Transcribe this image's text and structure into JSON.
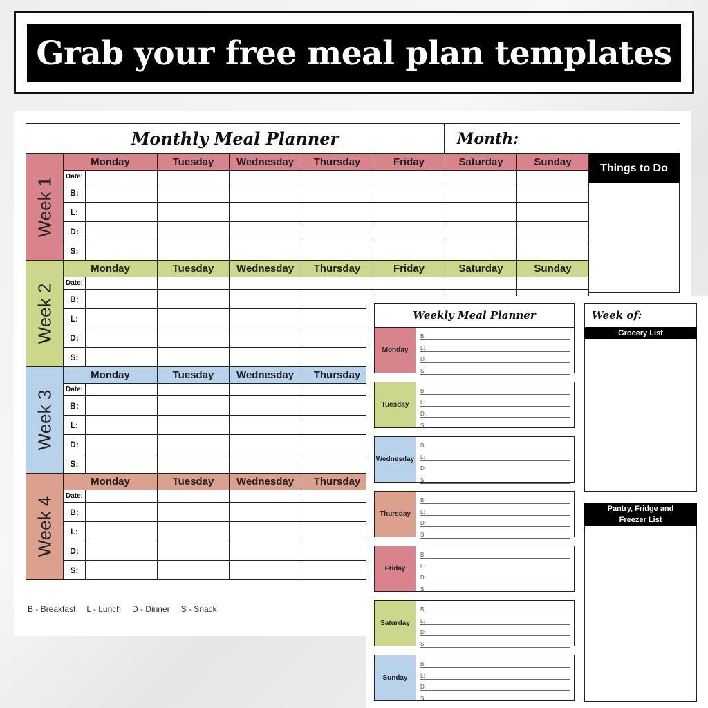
{
  "banner": {
    "title": "Grab your free meal plan templates"
  },
  "monthly": {
    "title": "Monthly Meal Planner",
    "month_label": "Month:",
    "things_to_do": "Things to Do",
    "days": [
      "Monday",
      "Tuesday",
      "Wednesday",
      "Thursday",
      "Friday",
      "Saturday",
      "Sunday"
    ],
    "row_labels": [
      "Date:",
      "B:",
      "L:",
      "D:",
      "S:"
    ],
    "weeks": [
      {
        "label": "Week 1",
        "color": "#d9848c"
      },
      {
        "label": "Week 2",
        "color": "#cdd78c"
      },
      {
        "label": "Week 3",
        "color": "#b8d2ec"
      },
      {
        "label": "Week 4",
        "color": "#dca08e"
      }
    ],
    "legend": [
      "B - Breakfast",
      "L - Lunch",
      "D - Dinner",
      "S - Snack"
    ]
  },
  "weekly": {
    "title": "Weekly Meal Planner",
    "week_of": "Week of:",
    "grocery_list": "Grocery List",
    "pantry_list": "Pantry, Fridge and Freezer List",
    "meal_labels": [
      "B:",
      "L:",
      "D:",
      "S:"
    ],
    "days": [
      {
        "label": "Monday",
        "color": "#d9848c"
      },
      {
        "label": "Tuesday",
        "color": "#cdd78c"
      },
      {
        "label": "Wednesday",
        "color": "#b8d2ec"
      },
      {
        "label": "Thursday",
        "color": "#dca08e"
      },
      {
        "label": "Friday",
        "color": "#d9848c"
      },
      {
        "label": "Saturday",
        "color": "#cdd78c"
      },
      {
        "label": "Sunday",
        "color": "#b8d2ec"
      }
    ]
  }
}
